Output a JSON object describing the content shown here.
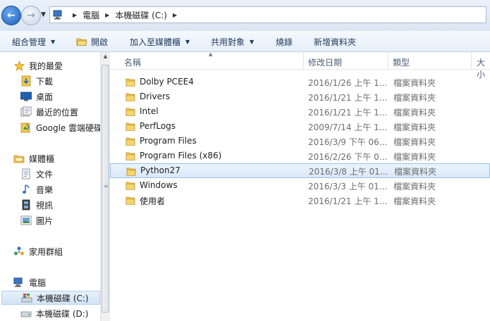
{
  "address": {
    "crumbs": [
      "電腦",
      "本機磁碟 (C:)"
    ]
  },
  "toolbar": {
    "organize": "組合管理",
    "open": "開啟",
    "add_to_library": "加入至媒體櫃",
    "share_with": "共用對象",
    "burn": "燒錄",
    "new_folder": "新增資料夾"
  },
  "nav": {
    "favorites": "我的最愛",
    "downloads": "下載",
    "desktop": "桌面",
    "recent": "最近的位置",
    "google_drive": "Google 雲端硬碟",
    "libraries": "媒體櫃",
    "documents": "文件",
    "music": "音樂",
    "videos": "視訊",
    "pictures": "圖片",
    "homegroup": "家用群組",
    "computer": "電腦",
    "drive_c": "本機磁碟 (C:)",
    "drive_d": "本機磁碟 (D:)"
  },
  "columns": {
    "name": "名稱",
    "date": "修改日期",
    "type": "類型",
    "size": "大小"
  },
  "files": [
    {
      "name": "Dolby PCEE4",
      "date": "2016/1/26 上午 1...",
      "type": "檔案資料夾"
    },
    {
      "name": "Drivers",
      "date": "2016/1/21 上午 1...",
      "type": "檔案資料夾"
    },
    {
      "name": "Intel",
      "date": "2016/1/21 上午 1...",
      "type": "檔案資料夾"
    },
    {
      "name": "PerfLogs",
      "date": "2009/7/14 上午 1...",
      "type": "檔案資料夾"
    },
    {
      "name": "Program Files",
      "date": "2016/3/9 下午 06...",
      "type": "檔案資料夾"
    },
    {
      "name": "Program Files (x86)",
      "date": "2016/2/26 下午 0...",
      "type": "檔案資料夾"
    },
    {
      "name": "Python27",
      "date": "2016/3/8 上午 01...",
      "type": "檔案資料夾"
    },
    {
      "name": "Windows",
      "date": "2016/3/3 上午 01...",
      "type": "檔案資料夾"
    },
    {
      "name": "使用者",
      "date": "2016/1/21 上午 1...",
      "type": "檔案資料夾"
    }
  ],
  "selected_file": "Python27",
  "colors": {
    "selection": "#d9e8f9",
    "selection_border": "#99c1ec",
    "folder": "#e8b84a"
  }
}
